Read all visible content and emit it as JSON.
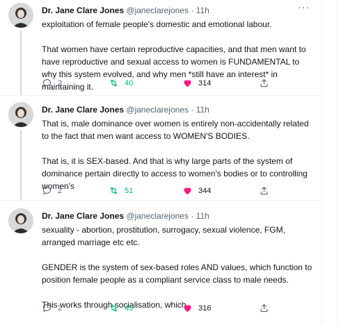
{
  "tweets": [
    {
      "name": "Dr. Jane Clare Jones",
      "handle": "@janeclarejones",
      "separator": "·",
      "time": "11h",
      "more": "···",
      "paragraphs": [
        "exploitation of female people's domestic and emotional labour.",
        "That women have certain reproductive capacities, and that men want to have reproductive and sexual access to women is FUNDAMENTAL to why this system evolved, and why men *still have an interest* in maintaining it."
      ],
      "replies": "2",
      "retweets": "40",
      "likes": "314"
    },
    {
      "name": "Dr. Jane Clare Jones",
      "handle": "@janeclarejones",
      "separator": "·",
      "time": "11h",
      "more": "···",
      "paragraphs": [
        "That is, male dominance over women is entirely non-accidentally related to the fact that men want access to WOMEN'S BODIES.",
        "That is, it is SEX-based. And that is why large parts of the system of dominance pertain directly to access to women's bodies or to controlling women's"
      ],
      "replies": "2",
      "retweets": "51",
      "likes": "344"
    },
    {
      "name": "Dr. Jane Clare Jones",
      "handle": "@janeclarejones",
      "separator": "·",
      "time": "11h",
      "more": "···",
      "paragraphs": [
        "sexuality - abortion, prostitution, surrogacy, sexual violence, FGM, arranged marriage etc etc.",
        "GENDER is the system of sex-based roles AND values, which function to position female people as a compliant service class to male needs.",
        "This works through socialisation, which"
      ],
      "replies": "2",
      "retweets": "45",
      "likes": "316"
    }
  ],
  "colors": {
    "retweet": "#00ba7c",
    "like": "#f91880",
    "secondary_text": "#536471",
    "border": "#eff3f4"
  }
}
